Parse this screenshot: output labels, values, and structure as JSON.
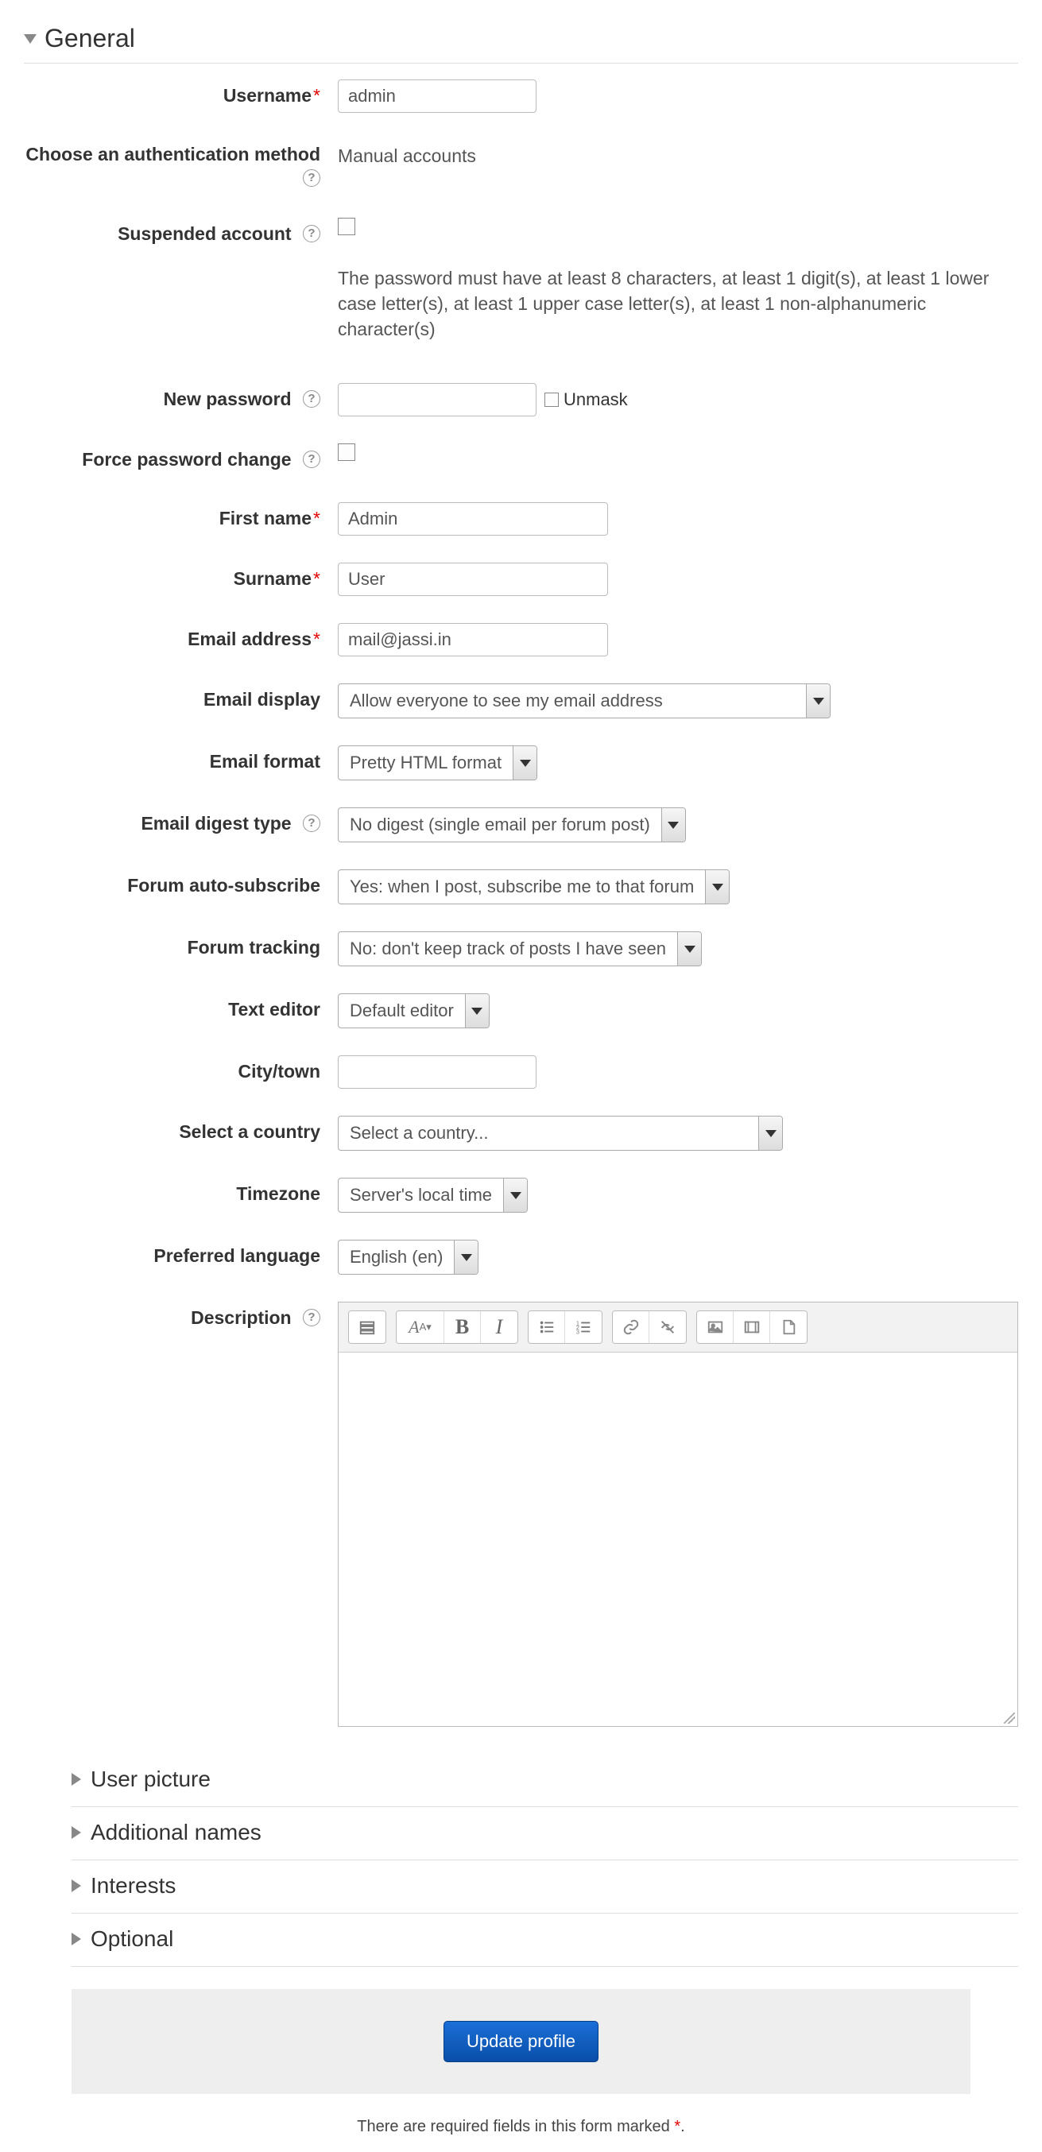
{
  "sections": {
    "general": "General",
    "user_picture": "User picture",
    "additional_names": "Additional names",
    "interests": "Interests",
    "optional": "Optional"
  },
  "labels": {
    "username": "Username",
    "auth_method": "Choose an authentication method",
    "suspended": "Suspended account",
    "new_password": "New password",
    "force_pw": "Force password change",
    "first_name": "First name",
    "surname": "Surname",
    "email": "Email address",
    "email_display": "Email display",
    "email_format": "Email format",
    "email_digest": "Email digest type",
    "forum_autosub": "Forum auto-subscribe",
    "forum_tracking": "Forum tracking",
    "text_editor": "Text editor",
    "city": "City/town",
    "country": "Select a country",
    "timezone": "Timezone",
    "language": "Preferred language",
    "description": "Description",
    "unmask": "Unmask"
  },
  "values": {
    "username": "admin",
    "auth_method": "Manual accounts",
    "first_name": "Admin",
    "surname": "User",
    "email": "mail@jassi.in",
    "email_display": "Allow everyone to see my email address",
    "email_format": "Pretty HTML format",
    "email_digest": "No digest (single email per forum post)",
    "forum_autosub": "Yes: when I post, subscribe me to that forum",
    "forum_tracking": "No: don't keep track of posts I have seen",
    "text_editor": "Default editor",
    "city": "",
    "country": "Select a country...",
    "timezone": "Server's local time",
    "language": "English (en)"
  },
  "hints": {
    "password": "The password must have at least 8 characters, at least 1 digit(s), at least 1 lower case letter(s), at least 1 upper case letter(s), at least 1 non-alphanumeric character(s)"
  },
  "buttons": {
    "submit": "Update profile"
  },
  "footnote": "There are required fields in this form marked "
}
